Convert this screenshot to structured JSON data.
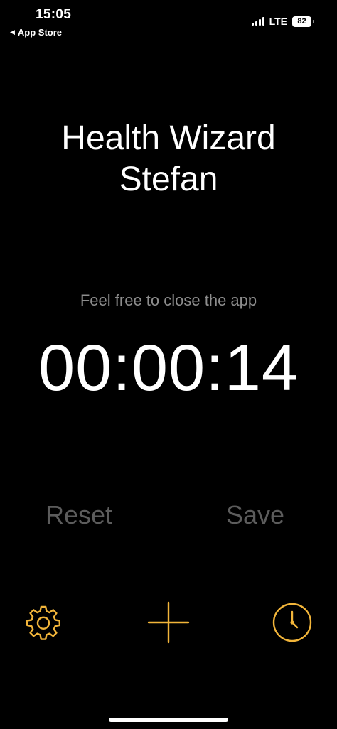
{
  "status_bar": {
    "time": "15:05",
    "back_label": "App Store",
    "network": "LTE",
    "battery": "82"
  },
  "title": {
    "line1": "Health Wizard",
    "line2": "Stefan"
  },
  "hint": "Feel free to close the app",
  "timer": "00:00:14",
  "actions": {
    "reset": "Reset",
    "save": "Save"
  },
  "toolbar": {
    "settings_icon": "gear-icon",
    "add_icon": "plus-icon",
    "history_icon": "clock-icon"
  },
  "colors": {
    "background": "#000000",
    "accent": "#F2B53A",
    "disabled": "#5C5C5C",
    "hint": "#8D8D8D"
  }
}
